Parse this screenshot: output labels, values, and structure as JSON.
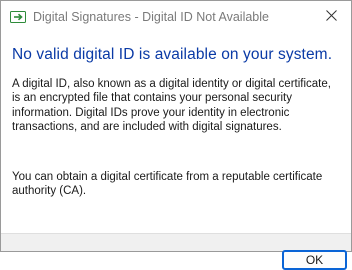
{
  "window": {
    "title": "Digital Signatures - Digital ID Not Available",
    "app_icon": "acrobat-arrow-icon",
    "close_icon": "close-icon"
  },
  "dialog": {
    "heading": "No valid digital ID is available on your system.",
    "paragraph1": "A digital ID, also known as a digital identity or digital certificate, is an encrypted file that contains your personal security information. Digital IDs prove your identity in electronic transactions, and are included with digital signatures.",
    "paragraph2": "You can obtain a digital certificate from a reputable certificate authority (CA).",
    "ok_label": "OK"
  },
  "colors": {
    "heading": "#0a3aa6",
    "accent": "#0a64d6",
    "footer_bg": "#f0f0f0"
  }
}
